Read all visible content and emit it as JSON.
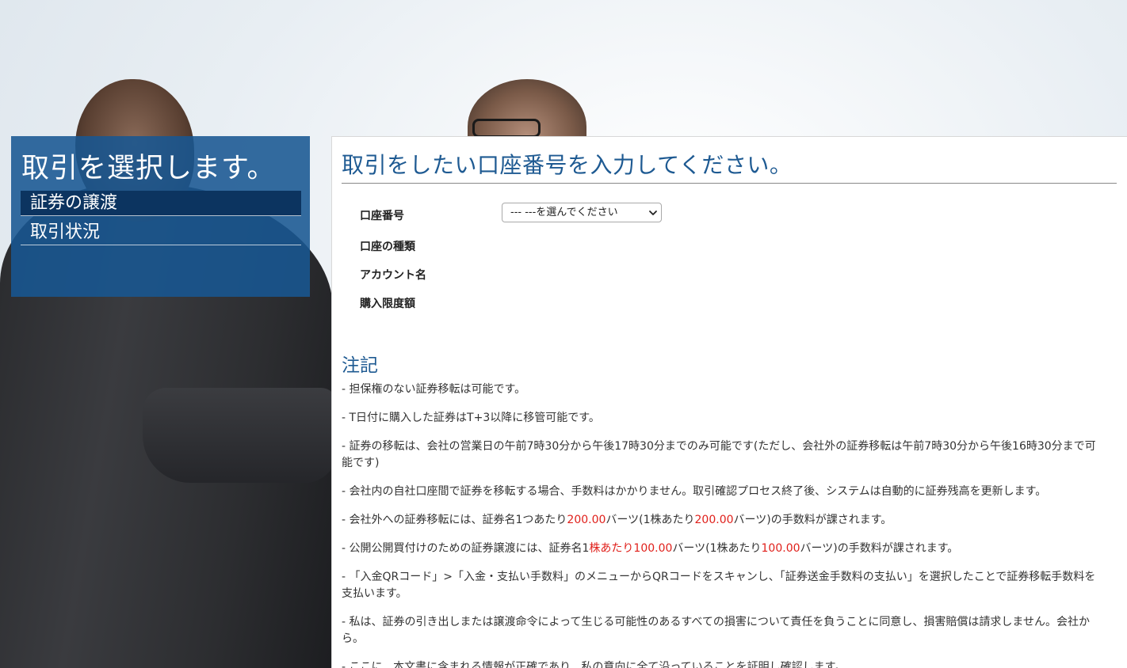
{
  "sidebar": {
    "title": "取引を選択します。",
    "items": [
      {
        "label": "証券の譲渡",
        "active": true
      },
      {
        "label": "取引状況",
        "active": false
      }
    ]
  },
  "main": {
    "title": "取引をしたい口座番号を入力してください。",
    "form": {
      "account_number_label": "口座番号",
      "account_select_value": "--- ---を選んでください",
      "account_type_label": "口座の種類",
      "account_name_label": "アカウント名",
      "purchase_limit_label": "購入限度額"
    },
    "notes_title": "注記",
    "notes": {
      "n1": "- 担保権のない証券移転は可能です。",
      "n2": "- T日付に購入した証券はT+3以降に移管可能です。",
      "n3": "- 証券の移転は、会社の営業日の午前7時30分から午後17時30分までのみ可能です(ただし、会社外の証券移転は午前7時30分から午後16時30分まで可能です)",
      "n4": "- 会社内の自社口座間で証券を移転する場合、手数料はかかりません。取引確認プロセス終了後、システムは自動的に証券残高を更新します。",
      "n5_a": "- 会社外への証券移転には、証券名1つあたり",
      "n5_b": "200.00",
      "n5_c": "バーツ(1株あたり",
      "n5_d": "200.00",
      "n5_e": "バーツ)の手数料が課されます。",
      "n6_a": "- 公開公開買付けのための証券譲渡には、証券名1",
      "n6_b": "株あたり",
      "n6_c": "100.00",
      "n6_d": "バーツ(1株あたり",
      "n6_e": "100.00",
      "n6_f": "バーツ)の手数料が課されます。",
      "n7": "- 「入金QRコード」>「入金・支払い手数料」のメニューからQRコードをスキャンし、「証券送金手数料の支払い」を選択したことで証券移転手数料を支払います。",
      "n8": "- 私は、証券の引き出しまたは譲渡命令によって生じる可能性のあるすべての損害について責任を負うことに同意し、損害賠償は請求しません。会社から。",
      "n9": "- ここに、本文書に含まれる情報が正確であり、私の意向に全て沿っていることを証明し確認します。"
    }
  },
  "colors": {
    "panel_blue": "#185692",
    "active_item": "#0c3460",
    "title_blue": "#1e5a92",
    "highlight_red": "#e0201b"
  }
}
